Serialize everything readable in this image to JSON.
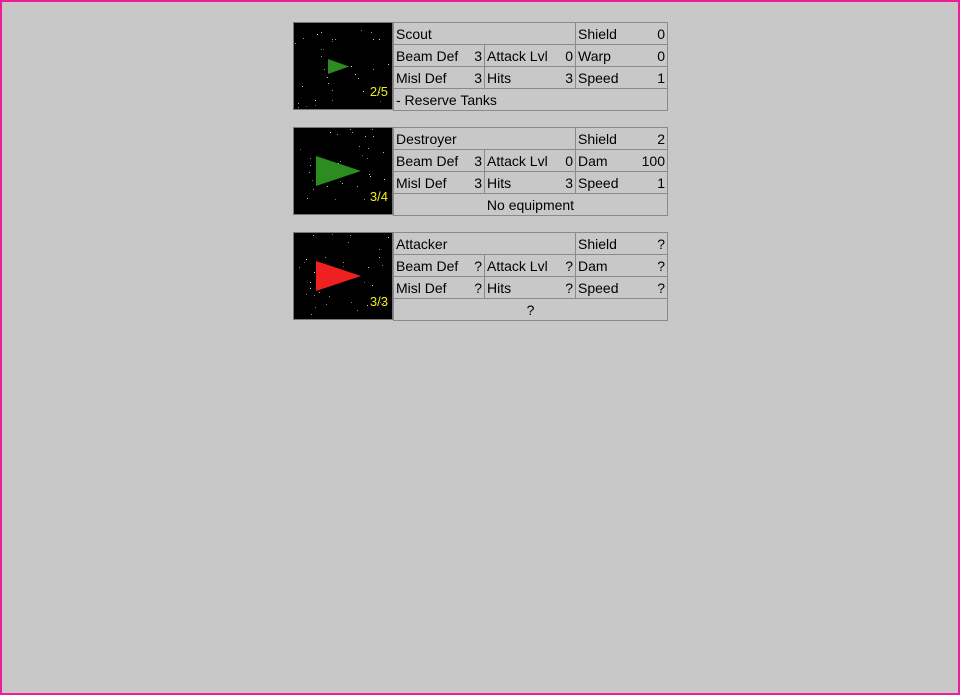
{
  "ships": [
    {
      "name": "Scout",
      "count": "2/5",
      "hull_color": "#2d8c1f",
      "shield_label": "Shield",
      "shield": "0",
      "beam_def_label": "Beam Def",
      "beam_def": "3",
      "attack_label": "Attack Lvl",
      "attack": "0",
      "third_label": "Warp",
      "third": "0",
      "misl_def_label": "Misl Def",
      "misl_def": "3",
      "hits_label": "Hits",
      "hits": "3",
      "speed_label": "Speed",
      "speed": "1",
      "equipment": "- Reserve Tanks",
      "equip_align": "left",
      "ship_size": "small"
    },
    {
      "name": "Destroyer",
      "count": "3/4",
      "hull_color": "#2d8c1f",
      "shield_label": "Shield",
      "shield": "2",
      "beam_def_label": "Beam Def",
      "beam_def": "3",
      "attack_label": "Attack Lvl",
      "attack": "0",
      "third_label": "Dam",
      "third": "100",
      "misl_def_label": "Misl Def",
      "misl_def": "3",
      "hits_label": "Hits",
      "hits": "3",
      "speed_label": "Speed",
      "speed": "1",
      "equipment": "No equipment",
      "equip_align": "center",
      "ship_size": "large"
    },
    {
      "name": "Attacker",
      "count": "3/3",
      "hull_color": "#ee2020",
      "shield_label": "Shield",
      "shield": "?",
      "beam_def_label": "Beam Def",
      "beam_def": "?",
      "attack_label": "Attack Lvl",
      "attack": "?",
      "third_label": "Dam",
      "third": "?",
      "misl_def_label": "Misl Def",
      "misl_def": "?",
      "hits_label": "Hits",
      "hits": "?",
      "speed_label": "Speed",
      "speed": "?",
      "equipment": "?",
      "equip_align": "center",
      "ship_size": "large"
    }
  ],
  "colors": {
    "background": "#c8c8c8",
    "frame": "#ee1d93",
    "count_text": "#f3ee1a",
    "space": "#000000"
  }
}
